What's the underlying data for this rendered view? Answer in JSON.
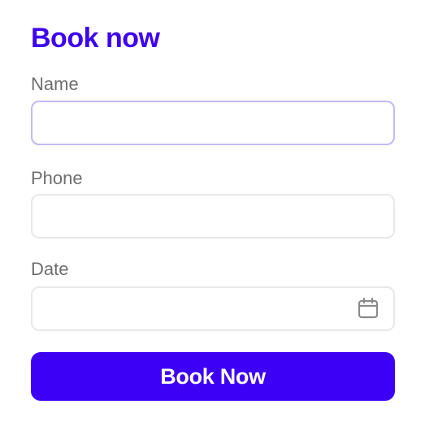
{
  "form": {
    "title": "Book now",
    "accent_color": "#3d00f5",
    "fields": {
      "name": {
        "label": "Name",
        "value": "",
        "placeholder": ""
      },
      "phone": {
        "label": "Phone",
        "value": "",
        "placeholder": ""
      },
      "date": {
        "label": "Date",
        "value": "",
        "placeholder": "",
        "icon": "calendar-icon"
      }
    },
    "submit_label": "Book Now"
  }
}
